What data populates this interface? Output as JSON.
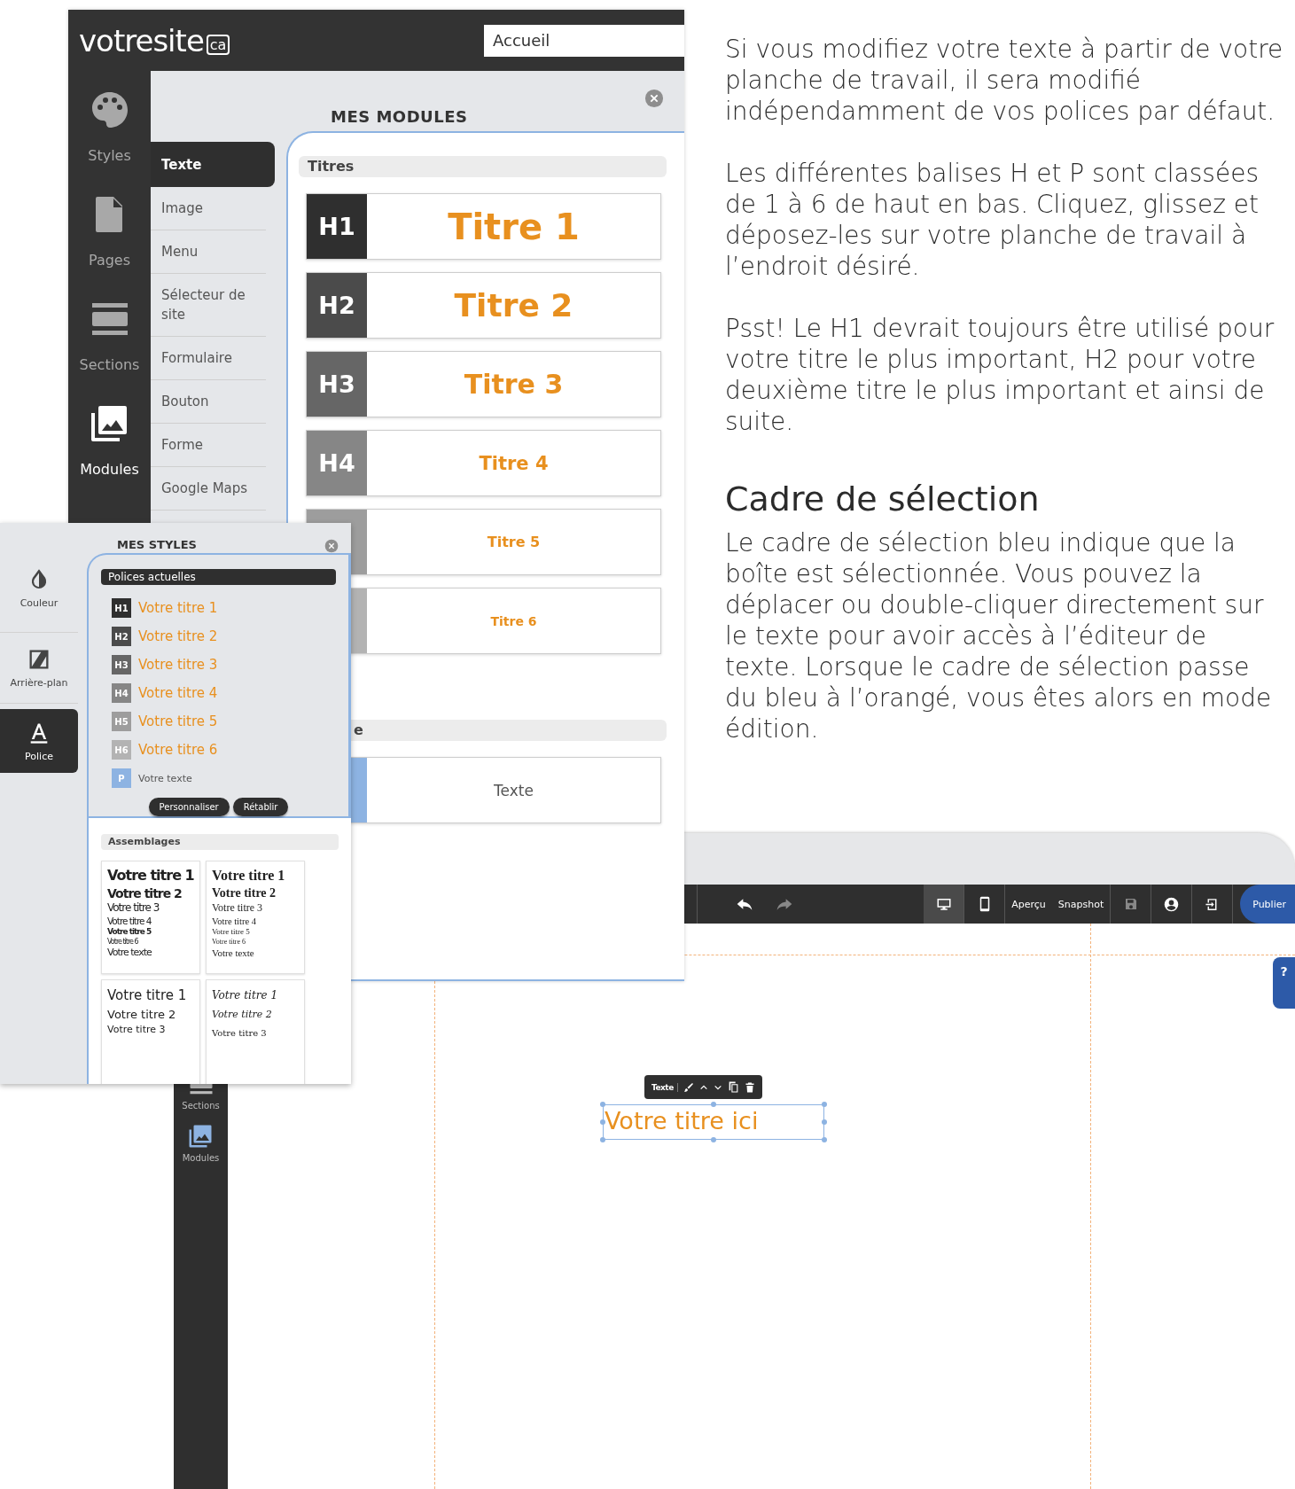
{
  "modules_window": {
    "logo": "votresite",
    "logo_suffix": "ca",
    "page_select": "Accueil",
    "sidebar": [
      {
        "label": "Styles",
        "selected": false
      },
      {
        "label": "Pages",
        "selected": false
      },
      {
        "label": "Sections",
        "selected": false
      },
      {
        "label": "Modules",
        "selected": true
      }
    ],
    "panel_title": "MES MODULES",
    "categories": [
      {
        "label": "Texte",
        "selected": true
      },
      {
        "label": "Image",
        "selected": false
      },
      {
        "label": "Menu",
        "selected": false
      },
      {
        "label": "Sélecteur de site",
        "selected": false
      },
      {
        "label": "Formulaire",
        "selected": false
      },
      {
        "label": "Bouton",
        "selected": false
      },
      {
        "label": "Forme",
        "selected": false
      },
      {
        "label": "Google Maps",
        "selected": false
      }
    ],
    "sections": [
      {
        "title": "Titres",
        "items": [
          {
            "kind": "heading",
            "tag": "H1",
            "label": "Titre 1"
          },
          {
            "kind": "heading",
            "tag": "H2",
            "label": "Titre 2"
          },
          {
            "kind": "heading",
            "tag": "H3",
            "label": "Titre 3"
          },
          {
            "kind": "heading",
            "tag": "H4",
            "label": "Titre 4"
          },
          {
            "kind": "heading",
            "label": "Titre 5"
          },
          {
            "kind": "heading",
            "label": "Titre 6"
          }
        ]
      },
      {
        "title": "e",
        "items": [
          {
            "kind": "paragraph",
            "label": "Texte"
          }
        ]
      }
    ]
  },
  "styles_window": {
    "sidebar": [
      {
        "label": "Couleur",
        "selected": false
      },
      {
        "label": "Arrière-plan",
        "selected": false
      },
      {
        "label": "Police",
        "selected": true
      }
    ],
    "panel_title": "MES STYLES",
    "fonts_title": "Polices actuelles",
    "fonts": [
      {
        "kind": "heading",
        "tag": "H1",
        "label": "Votre titre 1"
      },
      {
        "kind": "heading",
        "tag": "H2",
        "label": "Votre titre 2"
      },
      {
        "kind": "heading",
        "tag": "H3",
        "label": "Votre titre 3"
      },
      {
        "kind": "heading",
        "tag": "H4",
        "label": "Votre titre 4"
      },
      {
        "kind": "heading",
        "tag": "H5",
        "label": "Votre titre 5"
      },
      {
        "kind": "heading",
        "tag": "H6",
        "label": "Votre titre 6"
      },
      {
        "kind": "paragraph",
        "tag": "P",
        "label": "Votre texte"
      }
    ],
    "buttons": [
      "Personnaliser",
      "Rétablir"
    ],
    "sets_title": "Assemblages",
    "sets": [
      {
        "kind": "condensed",
        "lines": [
          "Votre titre 1",
          "Votre titre 2",
          "Votre titre 3",
          "Votre titre 4",
          "Votre titre 5",
          "Votre titre 6",
          "Votre texte"
        ]
      },
      {
        "kind": "serif",
        "lines": [
          "Votre titre 1",
          "Votre titre 2",
          "Votre titre 3",
          "Votre titre 4",
          "Votre titre 5",
          "Votre titre 6",
          "Votre texte"
        ]
      },
      {
        "kind": "sans",
        "lines": [
          "Votre titre 1",
          "Votre titre 2",
          "Votre titre 3"
        ]
      },
      {
        "kind": "script",
        "lines": [
          "Votre titre 1",
          "Votre titre 2",
          "Votre titre 3"
        ]
      }
    ]
  },
  "article": [
    {
      "kind": "paragraph",
      "text": "Si vous modifiez votre texte à partir de votre planche de travail, il sera modifié indépendamment de vos polices par défaut."
    },
    {
      "kind": "paragraph",
      "text": "Les différentes balises H et P sont classées de 1 à 6 de haut en bas. Cliquez, glissez et déposez-les sur votre planche de travail à l’endroit désiré."
    },
    {
      "kind": "paragraph",
      "text": "Psst! Le H1 devrait toujours être utilisé pour votre titre le plus important, H2 pour votre deuxième titre le plus important et ainsi de suite."
    },
    {
      "kind": "heading",
      "text": "Cadre de sélection"
    },
    {
      "kind": "paragraph",
      "text": "Le cadre de sélection bleu indique que la boîte est sélectionnée. Vous pouvez la déplacer ou double-cliquer directement sur le texte pour avoir accès à l’éditeur de texte. Lorsque le cadre de sélection passe du bleu à l’orangé, vous êtes alors en mode édition."
    }
  ],
  "editor": {
    "devices": [
      {
        "selected": true
      },
      {
        "selected": false
      }
    ],
    "actions": [
      "Aperçu",
      "Snapshot"
    ],
    "publish": "Publier",
    "sidebar": [
      {
        "label": "Sections",
        "selected": false
      },
      {
        "label": "Modules",
        "selected": true
      }
    ],
    "element_toolbar": {
      "label": "Texte"
    },
    "selected_text": "Votre titre ici",
    "help": "?"
  }
}
